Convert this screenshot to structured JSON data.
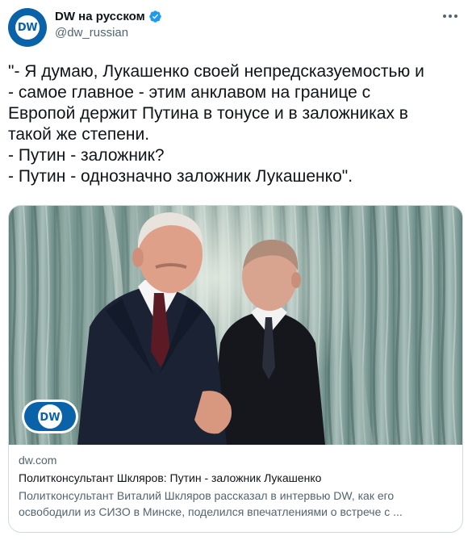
{
  "author": {
    "display_name": "DW на русском",
    "handle": "@dw_russian",
    "avatar_text": "DW"
  },
  "tweet": {
    "text": "\"- Я думаю, Лукашенко своей непредсказуемостью и\n- самое главное -  этим анклавом на границе с\nЕвропой держит Путина в тонусе и в заложниках в\nтакой же степени.\n- Путин - заложник?\n- Путин - однозначно заложник Лукашенко\"."
  },
  "card": {
    "domain": "dw.com",
    "title": "Политконсультант Шкляров: Путин - заложник Лукашенко",
    "description": "Политконсультант Виталий Шкляров рассказал в интервью DW, как его освободили из СИЗО в Минске, поделился впечатлениями о встрече с ...",
    "image_logo_text": "DW"
  },
  "colors": {
    "brand_blue": "#0a62a8",
    "verified_blue": "#1d9bf0",
    "muted_text": "#536471",
    "border": "#cfd9de"
  },
  "icons": [
    "verified-badge-icon",
    "more-options-icon",
    "dw-logo"
  ]
}
